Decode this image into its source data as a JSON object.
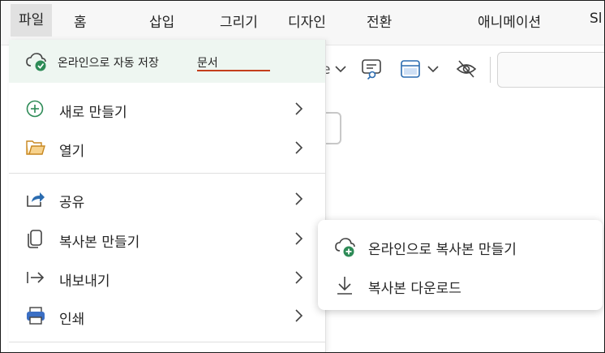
{
  "ribbon": {
    "tabs": [
      {
        "label": "파일"
      },
      {
        "label": "홈"
      },
      {
        "label": "삽입"
      },
      {
        "label": "그리기"
      },
      {
        "label": "디자인"
      },
      {
        "label": "전환"
      },
      {
        "label": "애니메이션"
      },
      {
        "label": "Sl"
      }
    ],
    "partial_label": "e"
  },
  "file_menu": {
    "autosave_label": "온라인으로 자동 저장",
    "document_name": "문서",
    "items": [
      {
        "label": "새로 만들기",
        "icon": "plus-circle-icon"
      },
      {
        "label": "열기",
        "icon": "folder-icon"
      },
      {
        "label": "공유",
        "icon": "share-icon"
      },
      {
        "label": "복사본 만들기",
        "icon": "copy-icon"
      },
      {
        "label": "내보내기",
        "icon": "export-icon"
      },
      {
        "label": "인쇄",
        "icon": "printer-icon"
      }
    ]
  },
  "submenu": {
    "items": [
      {
        "label": "온라인으로 복사본 만들기",
        "icon": "cloud-add-icon"
      },
      {
        "label": "복사본 다운로드",
        "icon": "download-icon"
      }
    ]
  },
  "colors": {
    "accent_green": "#2e8b57",
    "doc_underline": "#c43e1c",
    "folder": "#e8a33d",
    "share": "#2b6cb0",
    "printer": "#3b6fc4"
  }
}
